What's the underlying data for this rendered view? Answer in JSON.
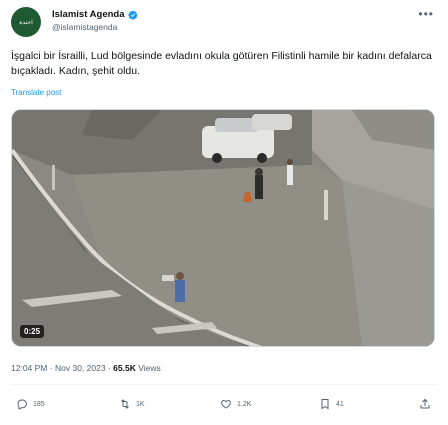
{
  "author": {
    "name": "Islamist Agenda",
    "handle": "@islamistagenda",
    "avatar_text": "اجندة"
  },
  "post": {
    "text": "İşgalci bir İsrailli, Lud bölgesinde evladını okula götüren Filistinli hamile bir kadını defalarca bıçakladı. Kadın, şehit oldu.",
    "translate_label": "Translate post",
    "video_duration": "0:25"
  },
  "meta": {
    "time": "12:04 PM",
    "separator": "·",
    "date": "Nov 30, 2023",
    "views_count": "65.5K",
    "views_label": "Views"
  },
  "actions": {
    "replies": "185",
    "reposts": "1K",
    "likes": "1.2K",
    "bookmarks": "41"
  },
  "colors": {
    "accent": "#1d9bf0",
    "text_secondary": "#536471",
    "avatar_bg": "#1e5a32"
  }
}
